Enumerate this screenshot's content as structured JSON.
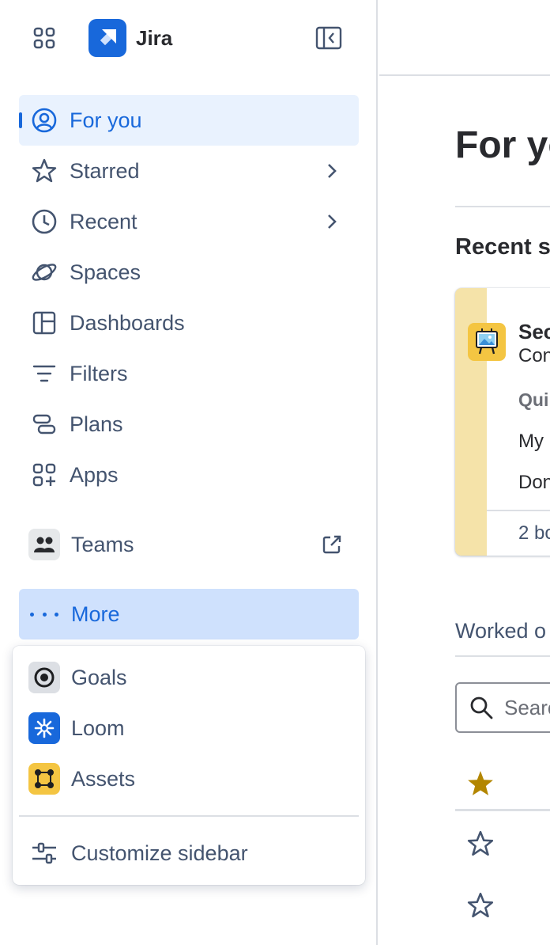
{
  "app": {
    "title": "Jira"
  },
  "nav": {
    "for_you": "For you",
    "starred": "Starred",
    "recent": "Recent",
    "spaces": "Spaces",
    "dashboards": "Dashboards",
    "filters": "Filters",
    "plans": "Plans",
    "apps": "Apps",
    "teams": "Teams",
    "more": "More"
  },
  "more_menu": {
    "goals": "Goals",
    "loom": "Loom",
    "assets": "Assets",
    "customize": "Customize sidebar"
  },
  "main": {
    "title": "For yo",
    "recent_heading": "Recent s",
    "card": {
      "name": "Sec",
      "subtitle": "Con",
      "quick_links": "Qui",
      "link1": "My",
      "link2": "Don",
      "footer": "2 bo"
    },
    "worked_heading": "Worked o",
    "search_placeholder": "Search"
  },
  "colors": {
    "accent": "#1868db",
    "selected_bg": "#e9f2fe",
    "more_bg": "#cfe1fd",
    "card_strip": "#f5e3a9",
    "star_filled": "#b38600"
  }
}
